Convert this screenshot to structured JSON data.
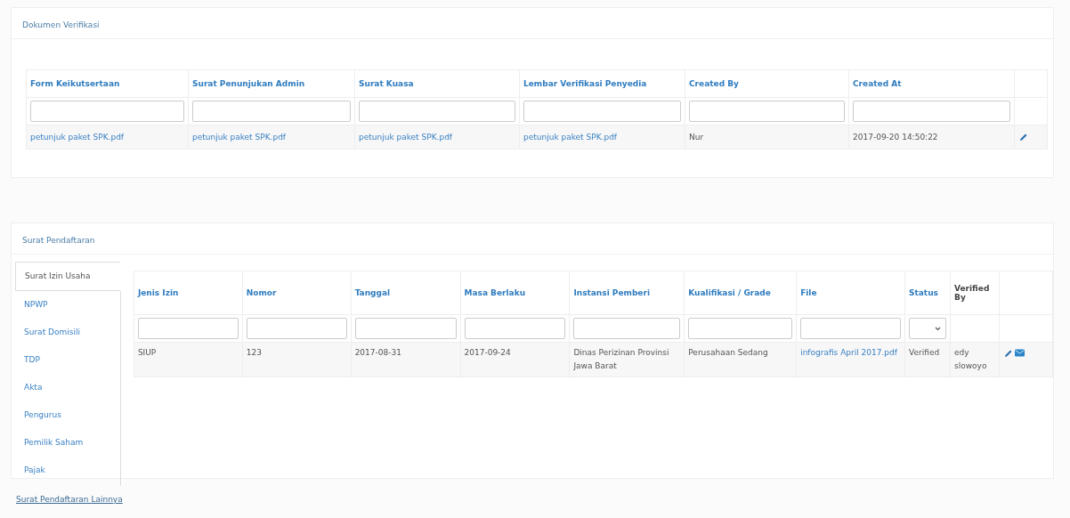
{
  "verification": {
    "title": "Dokumen Verifikasi",
    "columns": [
      {
        "label": "Form Keikutsertaan",
        "filter": {
          "kind": "text"
        }
      },
      {
        "label": "Surat Penunjukan Admin",
        "filter": {
          "kind": "text"
        }
      },
      {
        "label": "Surat Kuasa",
        "filter": {
          "kind": "text"
        }
      },
      {
        "label": "Lembar Verifikasi Penyedia",
        "filter": {
          "kind": "text"
        }
      },
      {
        "label": "Created By",
        "filter": {
          "kind": "text"
        }
      },
      {
        "label": "Created At",
        "filter": {
          "kind": "text"
        }
      }
    ],
    "rows": [
      {
        "cells": [
          {
            "text": "petunjuk paket SPK.pdf",
            "kind": "link"
          },
          {
            "text": "petunjuk paket SPK.pdf",
            "kind": "link"
          },
          {
            "text": "petunjuk paket SPK.pdf",
            "kind": "link"
          },
          {
            "text": "petunjuk paket SPK.pdf",
            "kind": "link"
          },
          {
            "text": "Nur",
            "kind": "text"
          },
          {
            "text": "2017-09-20 14:50:22",
            "kind": "text"
          }
        ]
      }
    ]
  },
  "registration": {
    "title": "Surat Pendaftaran",
    "tabs": [
      {
        "label": "Surat Izin Usaha",
        "selected": true
      },
      {
        "label": "NPWP",
        "selected": false
      },
      {
        "label": "Surat Domisili",
        "selected": false
      },
      {
        "label": "TDP",
        "selected": false
      },
      {
        "label": "Akta",
        "selected": false
      },
      {
        "label": "Pengurus",
        "selected": false
      },
      {
        "label": "Pemilik Saham",
        "selected": false
      },
      {
        "label": "Pajak",
        "selected": false
      }
    ],
    "columns": [
      {
        "label": "Jenis Izin",
        "filter": {
          "kind": "text"
        },
        "sortable": true
      },
      {
        "label": "Nomor",
        "filter": {
          "kind": "text"
        },
        "sortable": true
      },
      {
        "label": "Tanggal",
        "filter": {
          "kind": "text"
        },
        "sortable": true
      },
      {
        "label": "Masa Berlaku",
        "filter": {
          "kind": "text"
        },
        "sortable": true
      },
      {
        "label": "Instansi Pemberi",
        "filter": {
          "kind": "text"
        },
        "sortable": true
      },
      {
        "label": "Kualifikasi / Grade",
        "filter": {
          "kind": "text"
        },
        "sortable": true
      },
      {
        "label": "File",
        "filter": {
          "kind": "text"
        },
        "sortable": true
      },
      {
        "label": "Status",
        "filter": {
          "kind": "select"
        },
        "sortable": true
      },
      {
        "label": "Verified By",
        "sortable": false
      }
    ],
    "rows": [
      {
        "cells": [
          {
            "text": "SIUP",
            "kind": "text"
          },
          {
            "text": "123",
            "kind": "text"
          },
          {
            "text": "2017-08-31",
            "kind": "text"
          },
          {
            "text": "2017-09-24",
            "kind": "text"
          },
          {
            "text": "Dinas Perizinan Provinsi Jawa Barat",
            "kind": "text"
          },
          {
            "text": "Perusahaan Sedang",
            "kind": "text"
          },
          {
            "text": "infografis April 2017.pdf",
            "kind": "link"
          },
          {
            "text": "Verified",
            "kind": "text"
          },
          {
            "text": "edy slowoyo",
            "kind": "text"
          }
        ]
      }
    ]
  },
  "other": {
    "title": "Surat Pendaftaran Lainnya"
  }
}
